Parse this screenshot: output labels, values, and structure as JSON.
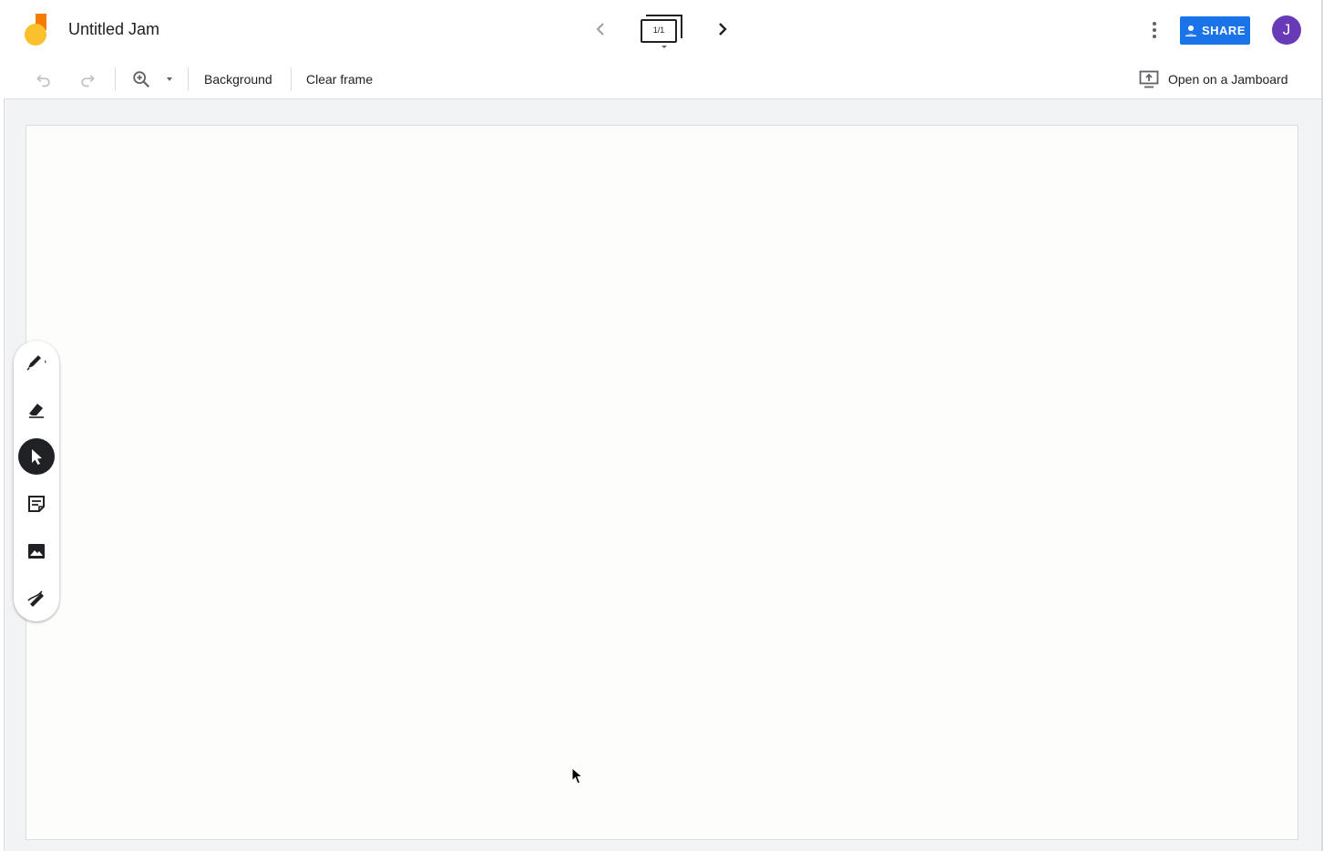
{
  "app": {
    "title": "Untitled Jam"
  },
  "header": {
    "frame_counter": "1/1",
    "share_label": "SHARE",
    "avatar_initial": "J"
  },
  "toolbar": {
    "background_label": "Background",
    "clear_frame_label": "Clear frame",
    "open_on_jamboard_label": "Open on a Jamboard"
  },
  "tools": [
    {
      "name": "pen",
      "icon": "pen-icon",
      "active": false
    },
    {
      "name": "eraser",
      "icon": "eraser-icon",
      "active": false
    },
    {
      "name": "select",
      "icon": "select-arrow-icon",
      "active": true
    },
    {
      "name": "sticky-note",
      "icon": "sticky-note-icon",
      "active": false
    },
    {
      "name": "image",
      "icon": "image-icon",
      "active": false
    },
    {
      "name": "laser",
      "icon": "laser-icon",
      "active": false
    }
  ],
  "colors": {
    "accent": "#1a73e8",
    "avatar": "#673ab7",
    "logo_orange": "#f57c00",
    "logo_yellow": "#fbc02d"
  }
}
